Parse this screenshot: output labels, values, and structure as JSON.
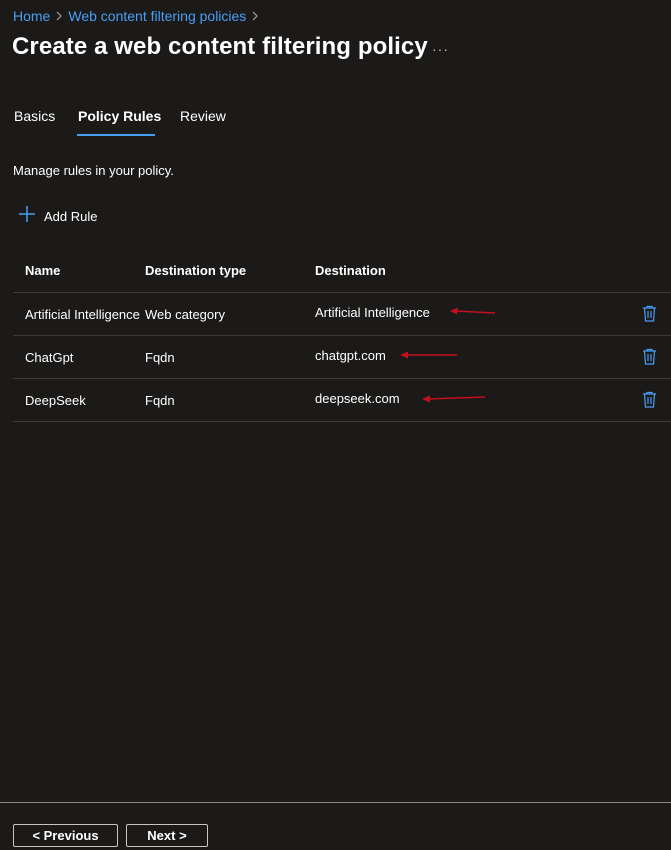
{
  "breadcrumb": {
    "items": [
      "Home",
      "Web content filtering policies"
    ]
  },
  "page": {
    "title": "Create a web content filtering policy",
    "more_label": "···"
  },
  "tabs": [
    {
      "label": "Basics",
      "active": false
    },
    {
      "label": "Policy Rules",
      "active": true
    },
    {
      "label": "Review",
      "active": false
    }
  ],
  "description": "Manage rules in your policy.",
  "add_rule": {
    "label": "Add Rule",
    "icon": "plus-icon"
  },
  "table": {
    "columns": [
      "Name",
      "Destination type",
      "Destination"
    ],
    "rows": [
      {
        "name": "Artificial Intelligence",
        "destination_type": "Web category",
        "destination": "Artificial Intelligence"
      },
      {
        "name": "ChatGpt",
        "destination_type": "Fqdn",
        "destination": "chatgpt.com"
      },
      {
        "name": "DeepSeek",
        "destination_type": "Fqdn",
        "destination": "deepseek.com"
      }
    ],
    "row_action_icon": "trash-icon"
  },
  "annotation": {
    "color": "#c50f1f"
  },
  "footer": {
    "previous_label": "< Previous",
    "next_label": "Next >"
  },
  "colors": {
    "background": "#1b1a19",
    "link": "#479ef5",
    "accent": "#479ef5"
  }
}
